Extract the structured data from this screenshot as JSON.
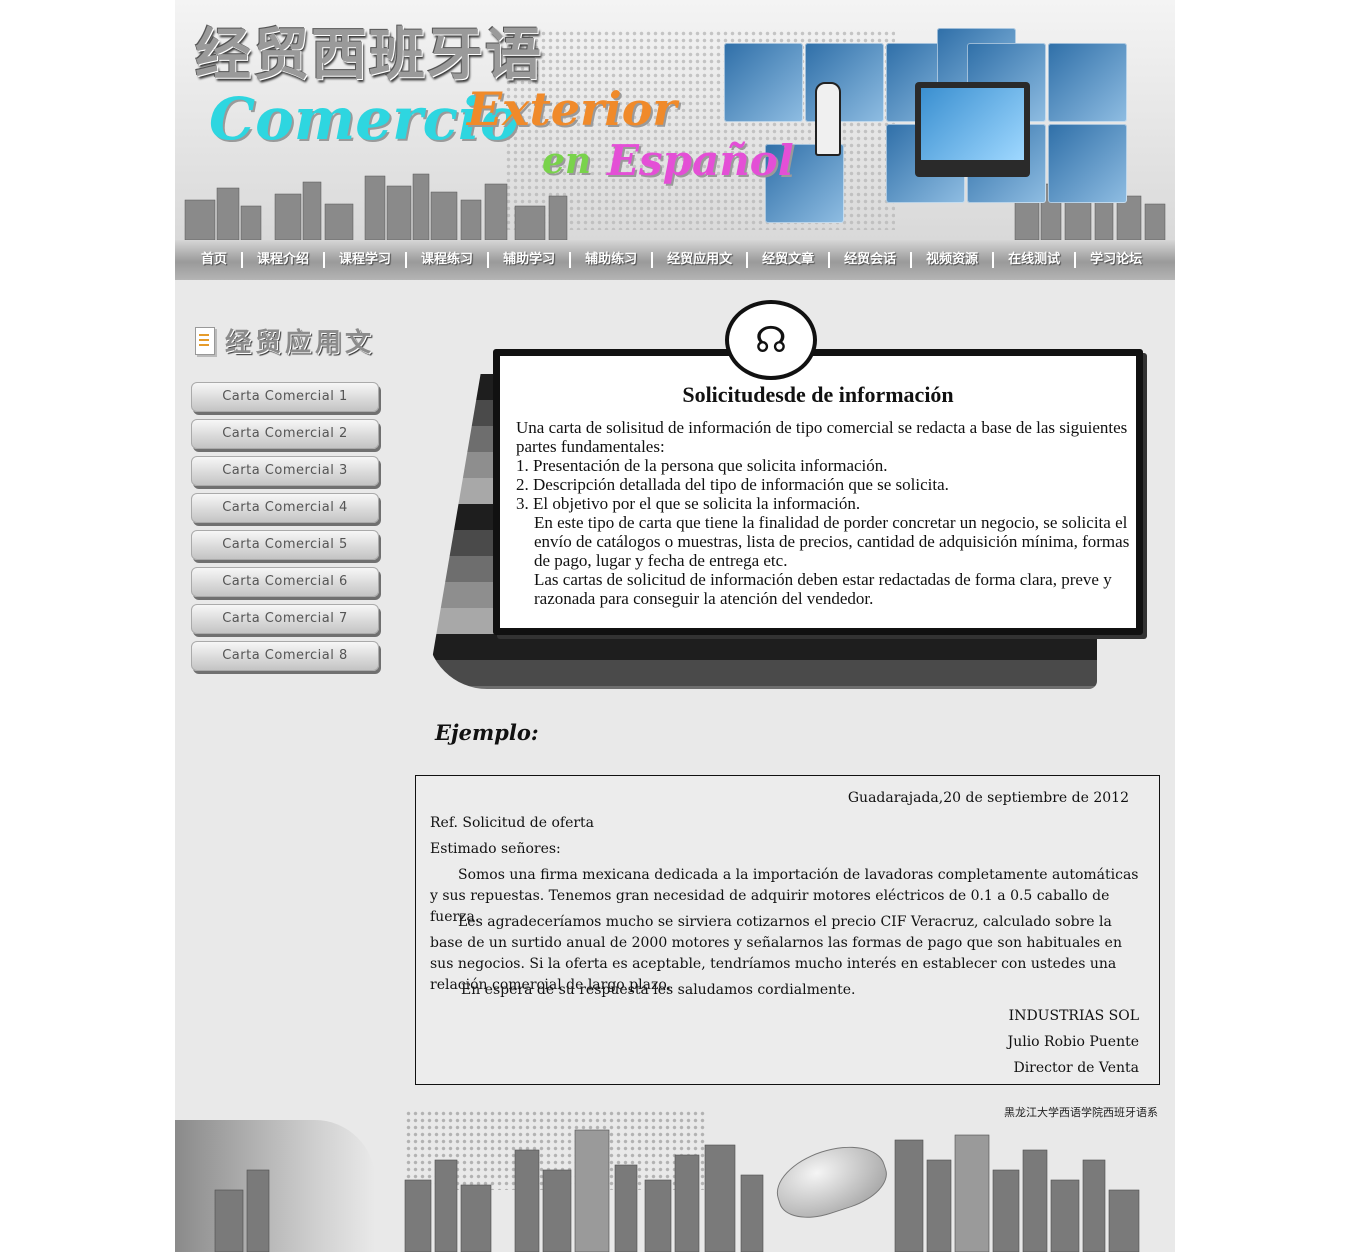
{
  "banner": {
    "title_cn": "经贸西班牙语",
    "title_es_1": "Comercio",
    "title_es_2": "Exterior",
    "title_es_3": "en",
    "title_es_4": "Español"
  },
  "nav": {
    "items": [
      "首页",
      "课程介绍",
      "课程学习",
      "课程练习",
      "辅助学习",
      "辅助练习",
      "经贸应用文",
      "经贸文章",
      "经贸会话",
      "视频资源",
      "在线测试",
      "学习论坛"
    ]
  },
  "sidebar": {
    "title": "经贸应用文",
    "items": [
      "Carta Comercial 1",
      "Carta Comercial 2",
      "Carta Comercial 3",
      "Carta Comercial 4",
      "Carta Comercial 5",
      "Carta Comercial 6",
      "Carta Comercial 7",
      "Carta Comercial 8"
    ]
  },
  "card": {
    "title": "Solicitudesde de información",
    "intro": "Una carta de solisitud de información de tipo comercial se redacta a base de las siguientes partes fundamentales:",
    "point1": "1. Presentación de la persona que solicita información.",
    "point2": "2. Descripción detallada del tipo de información que se solicita.",
    "point3": "3. El objetivo por el que se solicita la información.",
    "para1": "En este tipo de carta que tiene la finalidad de porder concretar un negocio, se solicita el envío de catálogos o muestras, lista de precios, cantidad de adquisición mínima, formas de pago, lugar y fecha de entrega etc.",
    "para2": "Las cartas de solicitud de información deben estar redactadas de forma clara, preve y razonada para conseguir la atención del vendedor."
  },
  "example": {
    "heading": "Ejemplo:",
    "date": "Guadarajada,20 de septiembre de 2012",
    "ref": "Ref. Solicitud de oferta",
    "greeting": "Estimado señores:",
    "p1": "Somos una firma mexicana dedicada a la importación de lavadoras completamente automáticas y sus repuestas. Tenemos gran necesidad de adquirir motores eléctricos de 0.1 a 0.5 caballo de fuerza.",
    "p2": "Les agradeceríamos mucho se sirviera cotizarnos el precio CIF Veracruz, calculado sobre la base de un surtido anual de 2000 motores y señalarnos las formas de pago que son habituales en sus negocios. Si la oferta es aceptable, tendríamos mucho interés en establecer con ustedes una relación comercial de largo plazo.",
    "p3": "En espera de su respuesta les saludamos cordialmente.",
    "sign1": "INDUSTRIAS SOL",
    "sign2": "Julio Robio Puente",
    "sign3": "Director de Venta"
  },
  "footer": {
    "credit": "黑龙江大学西语学院西班牙语系"
  }
}
